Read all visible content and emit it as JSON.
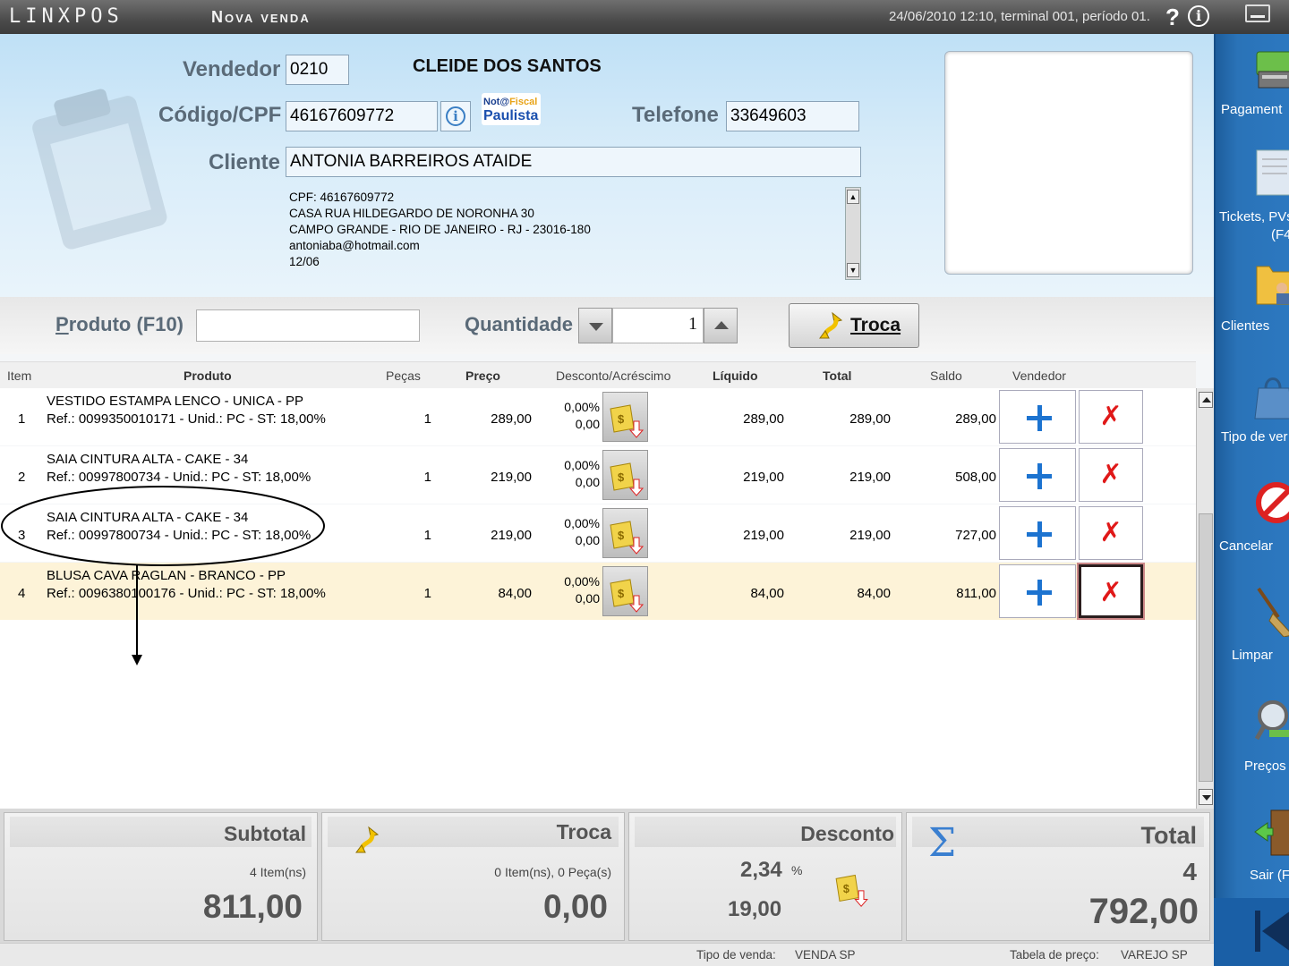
{
  "titlebar": {
    "logo": "LINXPOS",
    "screen_title": "Nova venda",
    "session_info": "24/06/2010 12:10, terminal 001, período 01.",
    "help_icon": "?",
    "info_icon": "i"
  },
  "header": {
    "vendedor_label": "Vendedor",
    "vendedor_code": "0210",
    "vendedor_name": "CLEIDE DOS SANTOS",
    "codigo_label": "Código/CPF",
    "codigo_value": "46167609772",
    "telefone_label": "Telefone",
    "telefone_value": "33649603",
    "cliente_label": "Cliente",
    "cliente_value": "ANTONIA BARREIROS ATAIDE",
    "nota_fiscal_logo_top": "Not@Fiscal",
    "nota_fiscal_logo_bottom": "Paulista",
    "client_details": [
      "CPF: 46167609772",
      "CASA RUA HILDEGARDO DE NORONHA 30",
      "CAMPO GRANDE - RIO DE JANEIRO - RJ - 23016-180",
      "antoniaba@hotmail.com",
      "12/06"
    ]
  },
  "product_bar": {
    "produto_label": "Produto (F10)",
    "produto_value": "",
    "quantidade_label": "Quantidade",
    "quantidade_value": "1",
    "troca_label": "Troca"
  },
  "grid": {
    "headers": {
      "item": "Item",
      "produto": "Produto",
      "pecas": "Peças",
      "preco": "Preço",
      "desconto": "Desconto/Acréscimo",
      "liquido": "Líquido",
      "total": "Total",
      "saldo": "Saldo",
      "vendedor": "Vendedor"
    },
    "rows": [
      {
        "item": "1",
        "name": "VESTIDO ESTAMPA LENCO - UNICA - PP",
        "ref": "Ref.: 0099350010171 - Unid.: PC - ST: 18,00%",
        "pecas": "1",
        "preco": "289,00",
        "desc_pct": "0,00%",
        "desc_val": "0,00",
        "liquido": "289,00",
        "total": "289,00",
        "saldo": "289,00"
      },
      {
        "item": "2",
        "name": "SAIA CINTURA ALTA - CAKE - 34",
        "ref": "Ref.: 00997800734 - Unid.: PC - ST: 18,00%",
        "pecas": "1",
        "preco": "219,00",
        "desc_pct": "0,00%",
        "desc_val": "0,00",
        "liquido": "219,00",
        "total": "219,00",
        "saldo": "508,00"
      },
      {
        "item": "3",
        "name": "SAIA CINTURA ALTA - CAKE - 34",
        "ref": "Ref.: 00997800734 - Unid.: PC - ST: 18,00%",
        "pecas": "1",
        "preco": "219,00",
        "desc_pct": "0,00%",
        "desc_val": "0,00",
        "liquido": "219,00",
        "total": "219,00",
        "saldo": "727,00"
      },
      {
        "item": "4",
        "name": "BLUSA CAVA RAGLAN - BRANCO - PP",
        "ref": "Ref.: 0096380100176 - Unid.: PC - ST: 18,00%",
        "pecas": "1",
        "preco": "84,00",
        "desc_pct": "0,00%",
        "desc_val": "0,00",
        "liquido": "84,00",
        "total": "84,00",
        "saldo": "811,00"
      }
    ]
  },
  "totals": {
    "subtotal_label": "Subtotal",
    "subtotal_items": "4 Item(ns)",
    "subtotal_value": "811,00",
    "troca_label": "Troca",
    "troca_items": "0 Item(ns), 0 Peça(s)",
    "troca_value": "0,00",
    "desconto_label": "Desconto",
    "desconto_pct": "2,34",
    "desconto_pct_sign": "%",
    "desconto_value": "19,00",
    "total_label": "Total",
    "total_count": "4",
    "total_value": "792,00"
  },
  "status": {
    "tipo_venda_label": "Tipo de venda:",
    "tipo_venda_value": "VENDA SP",
    "tabela_label": "Tabela de preço:",
    "tabela_value": "VAREJO SP"
  },
  "rail": {
    "items": [
      {
        "label": "Pagament",
        "icon": "payment-icon"
      },
      {
        "label": "Tickets, PVs",
        "label2": "(F4",
        "icon": "tickets-icon"
      },
      {
        "label": "Clientes",
        "icon": "clients-icon"
      },
      {
        "label": "Tipo de ver",
        "icon": "sale-type-icon"
      },
      {
        "label": "Cancelar",
        "icon": "cancel-icon"
      },
      {
        "label": "Limpar",
        "icon": "broom-icon"
      },
      {
        "label": "Preços",
        "icon": "price-lookup-icon"
      },
      {
        "label": "Sair (F",
        "icon": "exit-door-icon"
      }
    ]
  },
  "colors": {
    "header_bg": "#cfe7f7",
    "rail_bg": "#2a73b8",
    "selected_row": "#fdf3d8",
    "delete_red": "#e01818",
    "add_blue": "#1c73d0"
  }
}
